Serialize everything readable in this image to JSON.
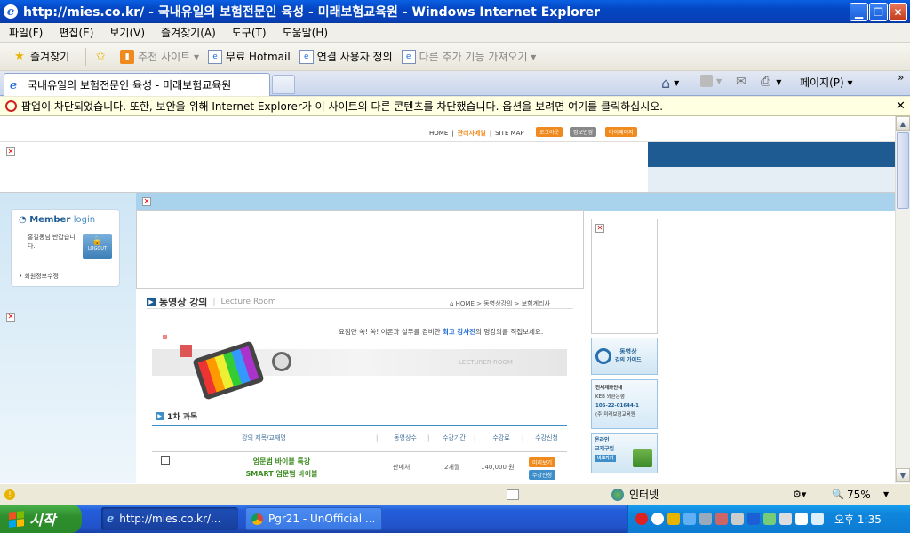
{
  "window": {
    "title": "http://mies.co.kr/ - 국내유일의 보험전문인 육성 - 미래보험교육원 - Windows Internet Explorer",
    "ie_glyph": "e"
  },
  "menubar": {
    "items": [
      "파일(F)",
      "편집(E)",
      "보기(V)",
      "즐겨찾기(A)",
      "도구(T)",
      "도움말(H)"
    ]
  },
  "favbar": {
    "favorites": "즐겨찾기",
    "links": [
      "추천 사이트 ▾",
      "무료 Hotmail",
      "연결 사용자 정의",
      "다른 추가 기능 가져오기 ▾"
    ]
  },
  "tabbar": {
    "tab_title": "국내유일의 보험전문인 육성 - 미래보험교육원",
    "page_menu": "페이지(P) ▾",
    "more": "»"
  },
  "infobar": {
    "message": "팝업이 차단되었습니다. 또한, 보안을 위해 Internet Explorer가 이 사이트의 다른 콘텐츠를 차단했습니다. 옵션을 보려면 여기를 클릭하십시오.",
    "close": "✕"
  },
  "page": {
    "topnav": {
      "home": "HOME",
      "admin": "관리자메일",
      "sitemap": "SITE MAP",
      "sep": "|"
    },
    "top_buttons": [
      "로그아웃",
      "정보변경",
      "마이페이지"
    ],
    "broken": "✕",
    "member": {
      "title": "Member",
      "title2": "login",
      "welcome": "홍길동님 반갑습니다.",
      "logout": "LOGOUT",
      "edit": "• 회원정보수정"
    },
    "section": {
      "title": "동영상 강의",
      "subtitle": "Lecture Room",
      "breadcrumb": "⌂ HOME > 동영상강의 > 보험계리사",
      "tagline_pre": "요점만 쏙! 쏙! 이론과 실무를 겸비한 ",
      "tagline_hl": "최고 강사진",
      "tagline_post": "의 명강의를 직접보세요.",
      "banner_text": "LECTURER ROOM",
      "course_label": "1차 과목"
    },
    "table": {
      "headers": [
        "강의 제목/교재명",
        "|",
        "동영상수",
        "|",
        "수강기간",
        "|",
        "수강료",
        "|",
        "수강신청"
      ],
      "row": {
        "title1": "엄문범 바이블 특강",
        "title2": "SMART 엄문범 바이블",
        "count": "판매처",
        "period": "2개월",
        "price": "140,000 원",
        "preview": "미리보기",
        "apply": "수강신청"
      }
    },
    "right_banners": {
      "video_guide": [
        "동영상",
        "강의 가이드"
      ],
      "account": [
        "전체계좌안내",
        "KEB 외환은행",
        "105-22-01644-1",
        "(주)미래보험교육원"
      ],
      "book": [
        "온라인",
        "교재구입",
        "바로가기"
      ]
    }
  },
  "statusbar": {
    "zone": "인터넷",
    "zoom": "75%",
    "zoom_icon": "🔍"
  },
  "taskbar": {
    "start": "시작",
    "tasks": [
      "http://mies.co.kr/...",
      "Pgr21 - UnOfficial ..."
    ],
    "clock": "오후 1:35"
  },
  "colors": {
    "accent": "#0a5fe3",
    "orange": "#f08a1c",
    "site_blue": "#1e5b93",
    "tray": "#0f86dd"
  }
}
